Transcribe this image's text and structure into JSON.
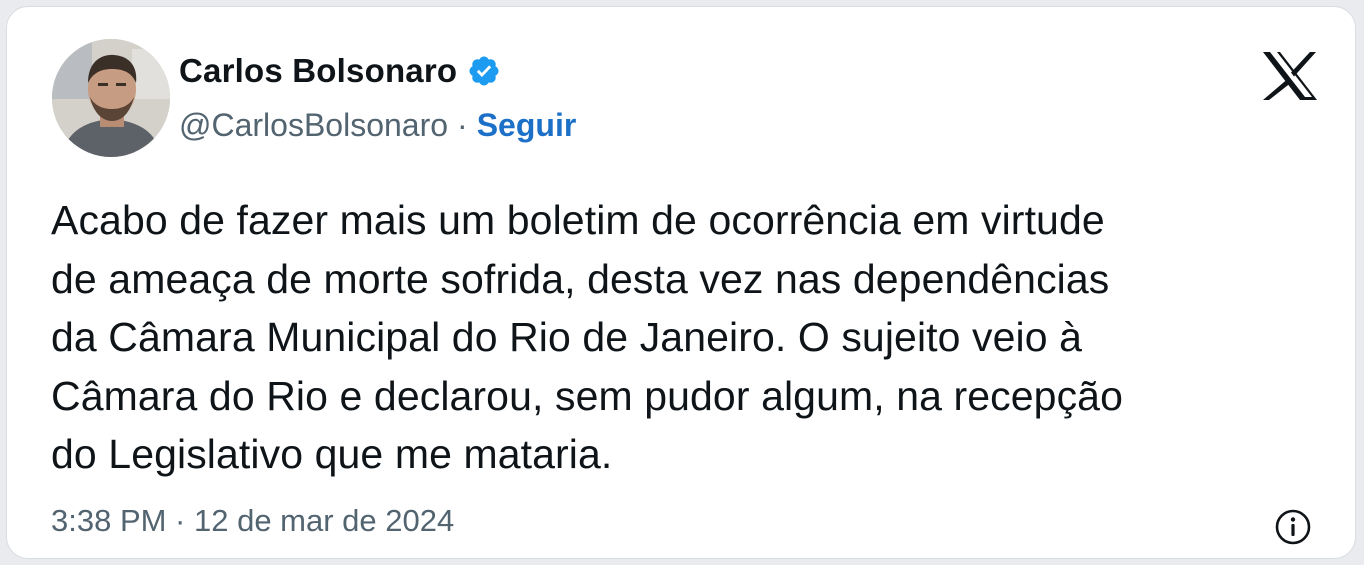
{
  "author": {
    "display_name": "Carlos Bolsonaro",
    "handle": "@CarlosBolsonaro",
    "separator": "·",
    "follow_label": "Seguir",
    "verified_icon": "verified-badge-icon",
    "avatar": "profile-photo"
  },
  "brand": {
    "logo_icon": "x-logo-icon"
  },
  "tweet": {
    "text": "Acabo de fazer mais um boletim de ocorrência em virtude\nde ameaça de morte sofrida, desta vez nas dependências\nda Câmara Municipal do Rio de Janeiro. O sujeito veio à\nCâmara do Rio e declarou, sem pudor algum, na recepção\ndo Legislativo que me mataria.",
    "timestamp": "3:38 PM · 12 de mar de 2024"
  },
  "footer": {
    "info_icon": "info-icon"
  },
  "colors": {
    "text": "#0f1419",
    "secondary": "#536471",
    "link": "#1d70c7",
    "verified": "#1d9bf0",
    "card_border": "#d8dde2"
  }
}
